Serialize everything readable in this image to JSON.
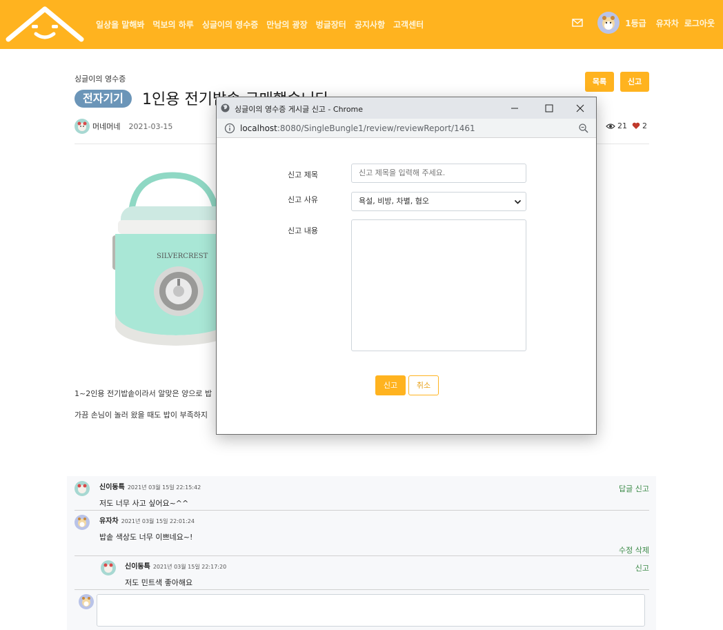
{
  "header": {
    "nav": [
      "일상을 말해봐",
      "먹보의 하루",
      "싱글이의 영수증",
      "만남의 광장",
      "벙글장터",
      "공지사항",
      "고객센터"
    ],
    "grade": "1등급",
    "username": "유자차",
    "logout": "로그아웃",
    "brand_color": "#ffb31f"
  },
  "post": {
    "category": "싱글이의 영수증",
    "badge": "전자기기",
    "title": "1인용 전기밥솥 구매했습니다",
    "list_button": "목록",
    "report_button": "신고",
    "author": "머네머네",
    "date": "2021-03-15",
    "views": "21",
    "likes": "2",
    "product_brand": "SILVERCREST",
    "body_lines": [
      "1~2인용 전기밥솥이라서 알맞은 양으로 밥",
      "가끔 손님이 놀러 왔을 때도 밥이 부족하지"
    ]
  },
  "popup": {
    "window_title": "싱글이의 영수증 게시글 신고 - Chrome",
    "url_host": "localhost",
    "url_rest": ":8080/SingleBungle1/review/reviewReport/1461",
    "title_label": "신고 제목",
    "title_placeholder": "신고 제목을 입력해 주세요.",
    "reason_label": "신고 사유",
    "reason_selected": "욕설, 비방, 차별, 혐오",
    "content_label": "신고 내용",
    "submit_label": "신고",
    "cancel_label": "취소"
  },
  "comments": [
    {
      "name": "신이동특",
      "date": "2021년 03월 15일 22:15:42",
      "text": "저도 너무 사고 싶어요~^^",
      "actions": "답글 신고"
    },
    {
      "name": "유자차",
      "date": "2021년 03월 15일 22:01:24",
      "text": "밥솥 색상도 너무 이쁘네요~!",
      "actions": "수정 삭제"
    },
    {
      "name": "신이동특",
      "date": "2021년 03월 15일 22:17:20",
      "text": "저도 민트색 좋아해요",
      "actions": "신고"
    }
  ]
}
